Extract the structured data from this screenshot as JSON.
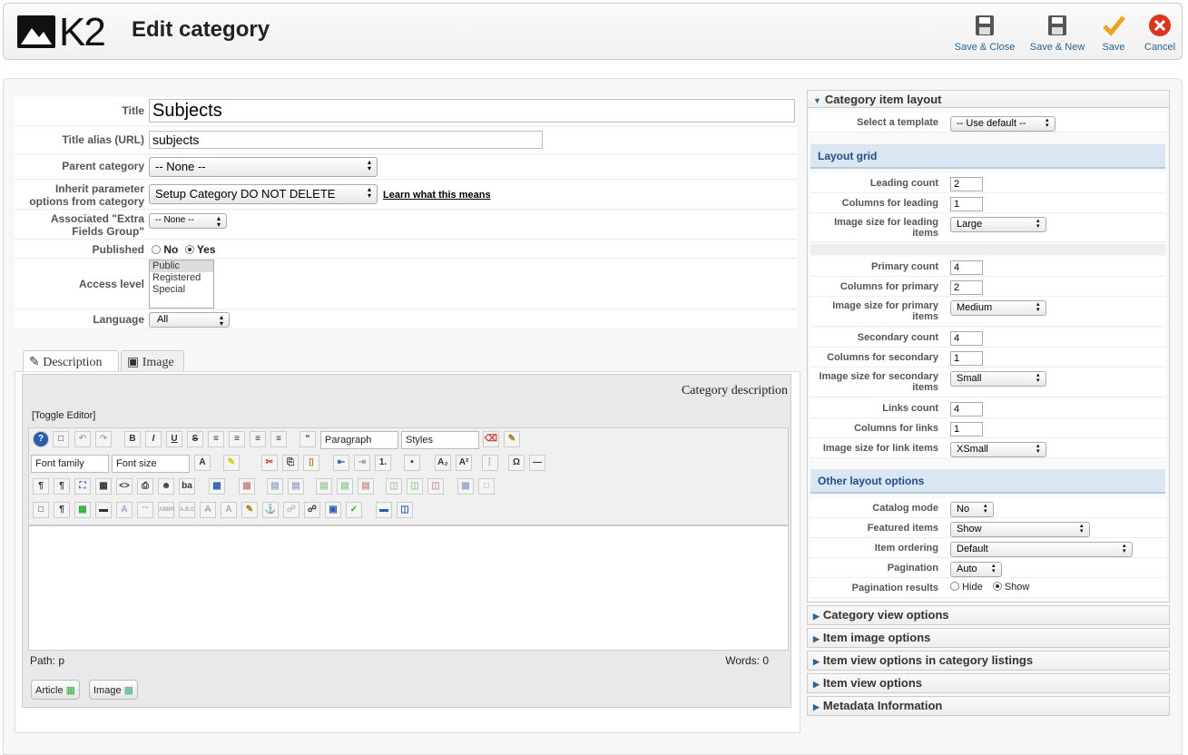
{
  "header": {
    "logo_text": "K2",
    "title": "Edit category",
    "buttons": [
      {
        "label": "Save & Close",
        "icon": "save-icon"
      },
      {
        "label": "Save & New",
        "icon": "save-icon"
      },
      {
        "label": "Save",
        "icon": "check-icon"
      },
      {
        "label": "Cancel",
        "icon": "cancel-icon"
      }
    ]
  },
  "form": {
    "title_label": "Title",
    "title_value": "Subjects",
    "alias_label": "Title alias (URL)",
    "alias_value": "subjects",
    "parent_label": "Parent category",
    "parent_value": "-- None --",
    "inherit_label": "Inherit parameter options from category",
    "inherit_value": "Setup Category DO NOT DELETE",
    "inherit_link": "Learn what this means",
    "extra_label": "Associated \"Extra Fields Group\"",
    "extra_value": "-- None --",
    "published_label": "Published",
    "published_no": "No",
    "published_yes": "Yes",
    "access_label": "Access level",
    "access_options": [
      "Public",
      "Registered",
      "Special"
    ],
    "language_label": "Language",
    "language_value": "All"
  },
  "tabs": {
    "description": "Description",
    "image": "Image"
  },
  "editor": {
    "caption": "Category description",
    "toggle": "[Toggle Editor]",
    "paragraph": "Paragraph",
    "styles": "Styles",
    "font_family": "Font family",
    "font_size": "Font size",
    "path": "Path:  p",
    "words": "Words: 0",
    "article_btn": "Article",
    "image_btn": "Image"
  },
  "right": {
    "panel_title": "Category item layout",
    "template_label": "Select a template",
    "template_value": "-- Use default --",
    "grid_title": "Layout grid",
    "leading_count_label": "Leading count",
    "leading_count": "2",
    "columns_leading_label": "Columns for leading",
    "columns_leading": "1",
    "img_leading_label": "Image size for leading items",
    "img_leading": "Large",
    "primary_count_label": "Primary count",
    "primary_count": "4",
    "columns_primary_label": "Columns for primary",
    "columns_primary": "2",
    "img_primary_label": "Image size for primary items",
    "img_primary": "Medium",
    "secondary_count_label": "Secondary count",
    "secondary_count": "4",
    "columns_secondary_label": "Columns for secondary",
    "columns_secondary": "1",
    "img_secondary_label": "Image size for secondary items",
    "img_secondary": "Small",
    "links_count_label": "Links count",
    "links_count": "4",
    "columns_links_label": "Columns for links",
    "columns_links": "1",
    "img_links_label": "Image size for link items",
    "img_links": "XSmall",
    "other_title": "Other layout options",
    "catalog_label": "Catalog mode",
    "catalog_value": "No",
    "featured_label": "Featured items",
    "featured_value": "Show",
    "ordering_label": "Item ordering",
    "ordering_value": "Default",
    "pagination_label": "Pagination",
    "pagination_value": "Auto",
    "pagres_label": "Pagination results",
    "pagres_hide": "Hide",
    "pagres_show": "Show",
    "collapsed": [
      "Category view options",
      "Item image options",
      "Item view options in category listings",
      "Item view options",
      "Metadata Information"
    ]
  },
  "colors": {
    "accent": "#2a6496",
    "section_bg": "#dbe6f3"
  }
}
